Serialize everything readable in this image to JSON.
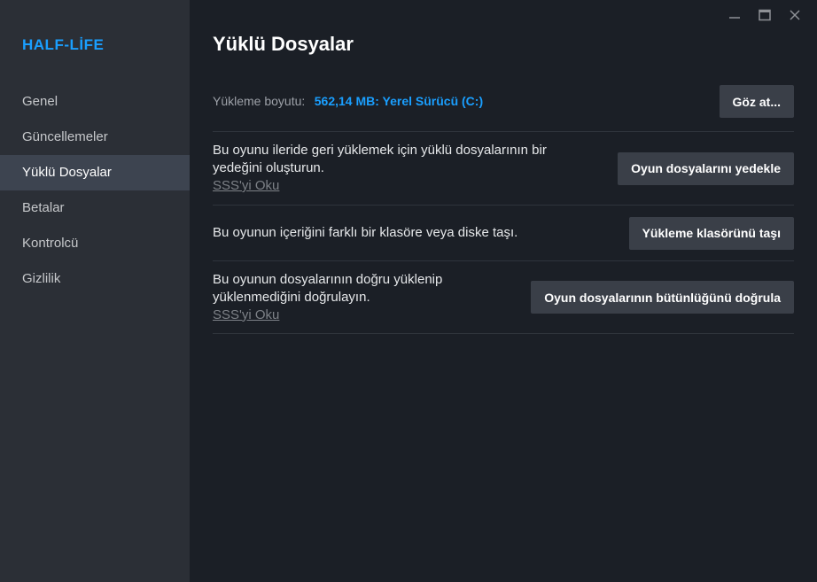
{
  "window": {
    "minimize_glyph": "—",
    "maximize_glyph": "☐",
    "close_glyph": "✕"
  },
  "sidebar": {
    "game_title": "HALF-LİFE",
    "items": [
      {
        "label": "Genel",
        "active": false
      },
      {
        "label": "Güncellemeler",
        "active": false
      },
      {
        "label": "Yüklü Dosyalar",
        "active": true
      },
      {
        "label": "Betalar",
        "active": false
      },
      {
        "label": "Kontrolcü",
        "active": false
      },
      {
        "label": "Gizlilik",
        "active": false
      }
    ]
  },
  "main": {
    "title": "Yüklü Dosyalar",
    "install_size": {
      "label": "Yükleme boyutu:",
      "value": "562,14 MB: Yerel Sürücü (C:)",
      "browse_button": "Göz at..."
    },
    "backup": {
      "text_line1": "Bu oyunu ileride geri yüklemek için yüklü dosyalarının bir",
      "text_line2": "yedeğini oluşturun.",
      "faq_link": "SSS'yi Oku",
      "button": "Oyun dosyalarını yedekle"
    },
    "move": {
      "text": "Bu oyunun içeriğini farklı bir klasöre veya diske taşı.",
      "button": "Yükleme klasörünü taşı"
    },
    "verify": {
      "text_line1": "Bu oyunun dosyalarının doğru yüklenip",
      "text_line2": "yüklenmediğini doğrulayın.",
      "faq_link": "SSS'yi Oku",
      "button": "Oyun dosyalarının bütünlüğünü doğrula"
    }
  },
  "colors": {
    "accent": "#1a9fff",
    "sidebar_bg": "#2b2f36",
    "main_bg": "#1b1f26",
    "active_item_bg": "#3d4450",
    "button_bg": "#3a3f48"
  }
}
